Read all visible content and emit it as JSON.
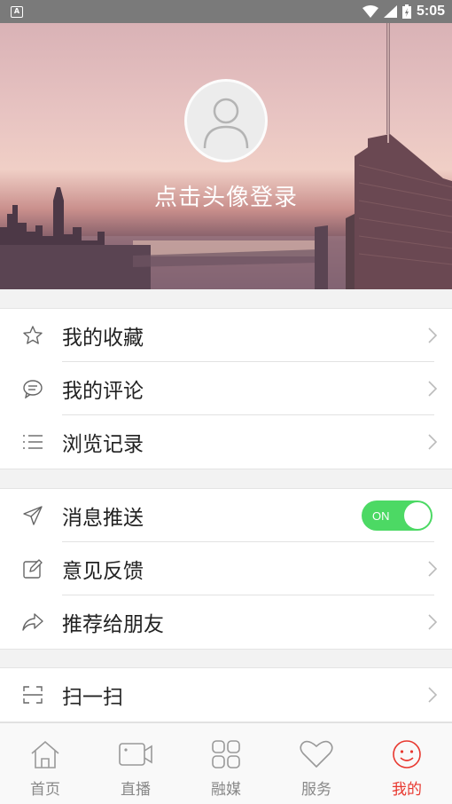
{
  "status_bar": {
    "time": "5:05",
    "notification_badge": "A"
  },
  "header": {
    "login_prompt": "点击头像登录"
  },
  "group1": {
    "items": [
      {
        "label": "我的收藏",
        "icon": "star-icon"
      },
      {
        "label": "我的评论",
        "icon": "comment-icon"
      },
      {
        "label": "浏览记录",
        "icon": "list-icon"
      }
    ]
  },
  "group2": {
    "items": [
      {
        "label": "消息推送",
        "icon": "send-icon",
        "toggle": "ON",
        "toggle_on": true
      },
      {
        "label": "意见反馈",
        "icon": "edit-icon"
      },
      {
        "label": "推荐给朋友",
        "icon": "share-icon"
      }
    ]
  },
  "group3": {
    "items": [
      {
        "label": "扫一扫",
        "icon": "scan-icon"
      }
    ]
  },
  "tabbar": {
    "tabs": [
      {
        "label": "首页",
        "icon": "home-icon"
      },
      {
        "label": "直播",
        "icon": "video-camera-icon"
      },
      {
        "label": "融媒",
        "icon": "grid-icon"
      },
      {
        "label": "服务",
        "icon": "heart-icon"
      },
      {
        "label": "我的",
        "icon": "smile-icon",
        "active": true
      }
    ]
  },
  "colors": {
    "accent": "#e8382f",
    "toggle_on": "#4cd964"
  }
}
